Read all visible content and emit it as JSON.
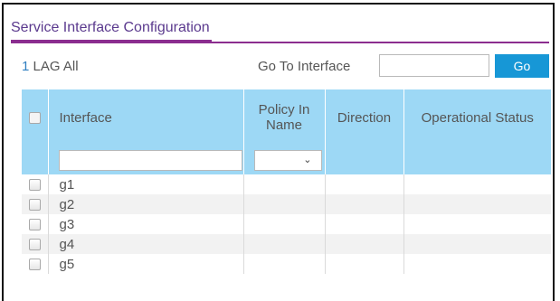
{
  "page": {
    "title": "Service Interface Configuration"
  },
  "toolbar": {
    "lag_count": "1",
    "lag_label": "LAG All",
    "goto_label": "Go To Interface",
    "goto_value": "",
    "go_button": "Go"
  },
  "table": {
    "columns": [
      "Interface",
      "Policy In Name",
      "Direction",
      "Operational Status"
    ],
    "rows": [
      {
        "interface": "g1"
      },
      {
        "interface": "g2"
      },
      {
        "interface": "g3"
      },
      {
        "interface": "g4"
      },
      {
        "interface": "g5"
      }
    ]
  },
  "icons": {
    "select_caret": "chevron-down-icon"
  },
  "colors": {
    "accent": "#8b2d8f",
    "header_bg": "#9dd8f5",
    "button_bg": "#1797d6",
    "link": "#2f7fc1"
  }
}
